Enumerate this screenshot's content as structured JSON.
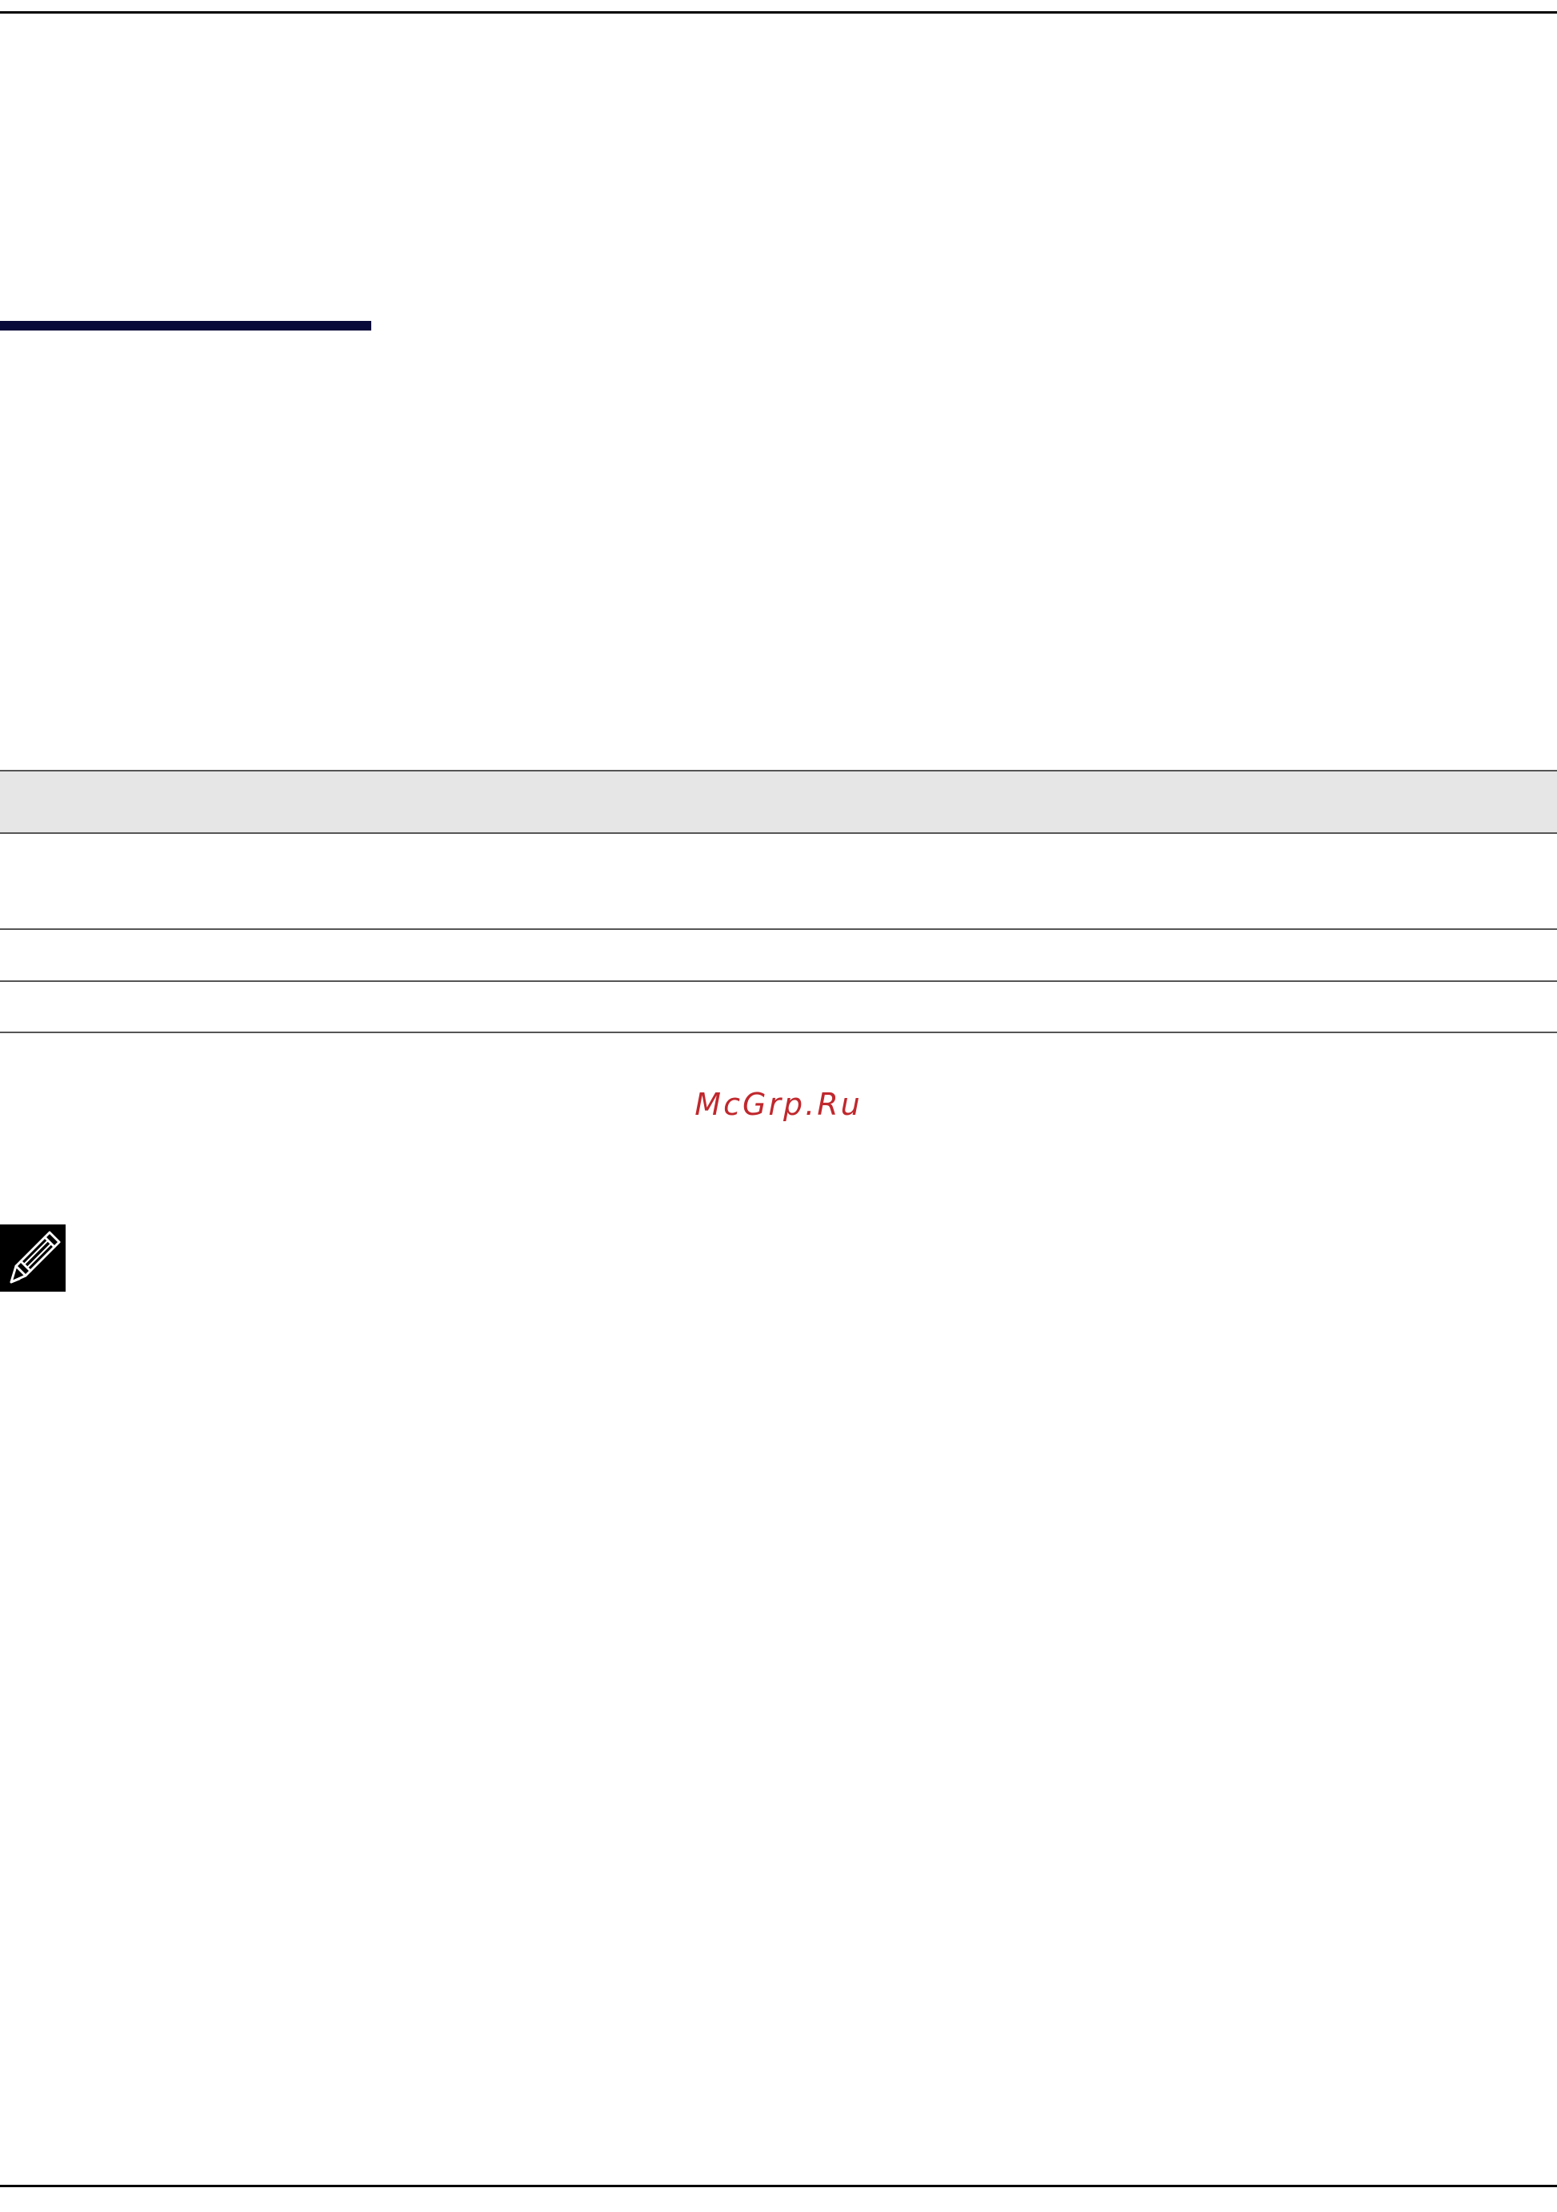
{
  "watermark": {
    "text": "McGrp.Ru",
    "color": "#c0282d"
  },
  "section_bar": {
    "color": "#0a0a3a"
  },
  "table": {
    "header_background": "#e6e6e6",
    "row_count": 3
  },
  "note": {
    "icon": "note-pencil-icon"
  }
}
